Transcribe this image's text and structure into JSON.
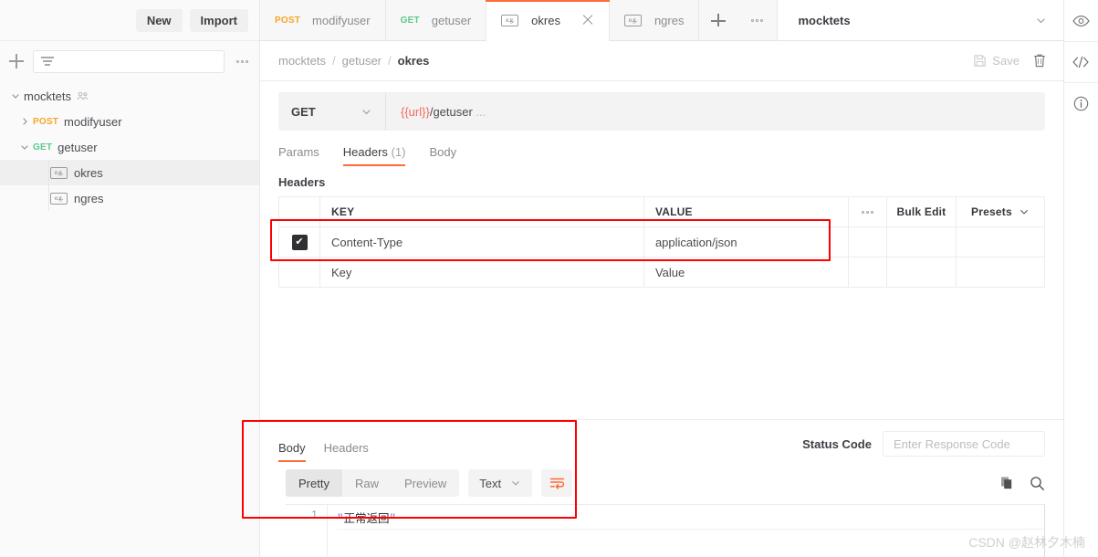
{
  "sidebar": {
    "new_label": "New",
    "import_label": "Import",
    "filter_placeholder": "",
    "add_icon": "plus-icon",
    "filter_icon": "filter-funnel-icon",
    "more_icon": "more-horizontal-icon",
    "tree": [
      {
        "label": "mocktets",
        "type": "collection",
        "expanded": true,
        "badge": "team-icon",
        "depth": 0,
        "selected": false
      },
      {
        "label": "modifyuser",
        "type": "request",
        "method": "POST",
        "expanded": false,
        "depth": 1,
        "selected": false
      },
      {
        "label": "getuser",
        "type": "request",
        "method": "GET",
        "expanded": true,
        "depth": 1,
        "selected": false
      },
      {
        "label": "okres",
        "type": "example",
        "badge": "e.g.",
        "depth": 2,
        "selected": true
      },
      {
        "label": "ngres",
        "type": "example",
        "badge": "e.g.",
        "depth": 2,
        "selected": false
      }
    ]
  },
  "tabstrip": {
    "tabs": [
      {
        "label": "modifyuser",
        "method": "POST",
        "active": false,
        "closable": false
      },
      {
        "label": "getuser",
        "method": "GET",
        "active": false,
        "closable": false
      },
      {
        "label": "okres",
        "badge": "e.g.",
        "active": true,
        "closable": true
      },
      {
        "label": "ngres",
        "badge": "e.g.",
        "active": false,
        "closable": false
      }
    ],
    "add_icon": "plus-icon",
    "more_icon": "more-horizontal-icon",
    "environment": "mocktets",
    "env_chevron": "chevron-down-icon"
  },
  "breadcrumb": {
    "parts": [
      "mocktets",
      "getuser",
      "okres"
    ],
    "separator": "/",
    "save_label": "Save",
    "save_icon": "floppy-disk-icon",
    "delete_icon": "trash-icon"
  },
  "request": {
    "method": "GET",
    "method_chevron": "chevron-down-icon",
    "url_variable": "{{url}}",
    "url_path": "/getuser",
    "url_ellipsis": "..."
  },
  "subtabs": [
    {
      "label": "Params",
      "count": "",
      "active": false
    },
    {
      "label": "Headers",
      "count": "(1)",
      "active": true
    },
    {
      "label": "Body",
      "count": "",
      "active": false
    }
  ],
  "headers_section": {
    "title": "Headers",
    "columns": {
      "key": "KEY",
      "value": "VALUE"
    },
    "more_icon": "more-horizontal-icon",
    "bulk_edit_label": "Bulk Edit",
    "presets_label": "Presets",
    "presets_chevron": "chevron-down-icon",
    "rows": [
      {
        "checked": true,
        "key": "Content-Type",
        "value": "application/json",
        "placeholder": false
      },
      {
        "checked": false,
        "key": "Key",
        "value": "Value",
        "placeholder": true
      }
    ],
    "check_glyph": "✔"
  },
  "response": {
    "tabs": [
      {
        "label": "Body",
        "active": true
      },
      {
        "label": "Headers",
        "active": false
      }
    ],
    "status_code_label": "Status Code",
    "status_code_placeholder": "Enter Response Code",
    "status_code_value": "",
    "viewer": {
      "modes": [
        {
          "label": "Pretty",
          "active": true
        },
        {
          "label": "Raw",
          "active": false
        },
        {
          "label": "Preview",
          "active": false
        }
      ],
      "format": "Text",
      "format_chevron": "chevron-down-icon",
      "wrap_icon": "wrap-text-icon",
      "copy_icon": "copy-icon",
      "search_icon": "search-icon"
    },
    "code": {
      "lines": [
        {
          "number": "1",
          "open_quote": "\"",
          "text": "正常返回",
          "close_quote": "\""
        }
      ]
    }
  },
  "right_rail": [
    {
      "icon": "eye-icon",
      "name": "preview"
    },
    {
      "icon": "code-icon",
      "name": "code"
    },
    {
      "icon": "info-icon",
      "name": "info"
    }
  ],
  "annotations": {
    "headers_box_color": "#ff0000",
    "body_box_color": "#ff0000"
  },
  "watermark": "CSDN @赵林夕木楠"
}
